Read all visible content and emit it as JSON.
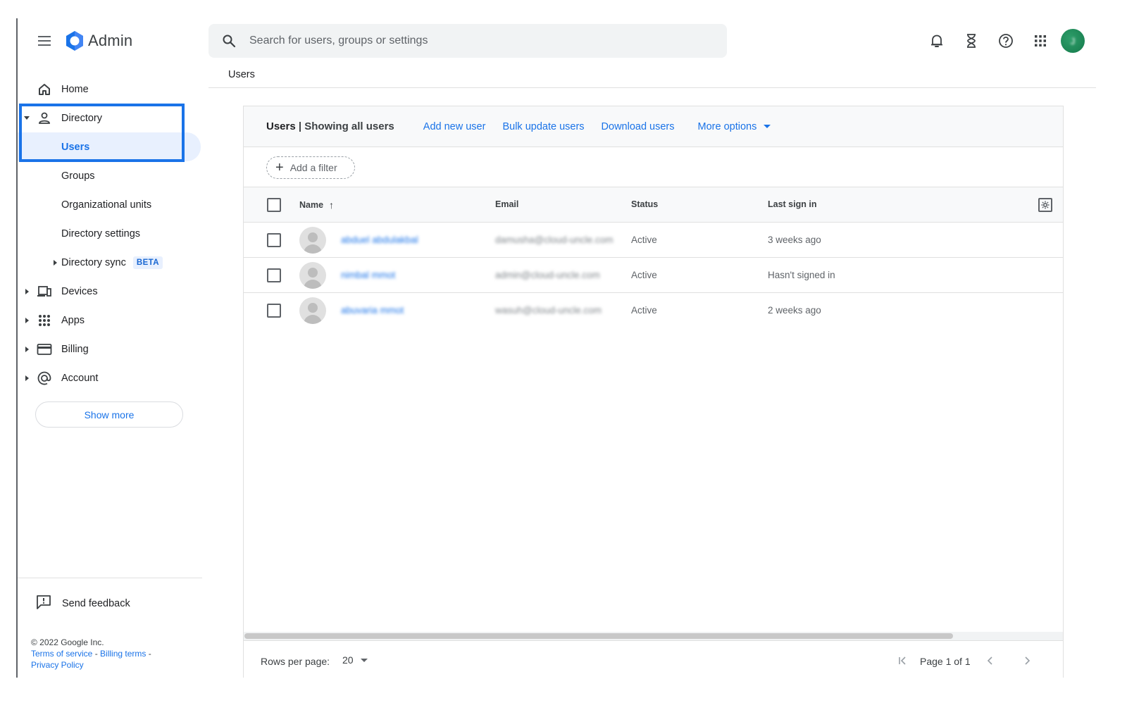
{
  "app": {
    "logo_text": "Admin"
  },
  "search": {
    "placeholder": "Search for users, groups or settings"
  },
  "header_icons": [
    "bell-icon",
    "hourglass-icon",
    "help-icon",
    "apps-grid-icon"
  ],
  "avatar_initial": "J",
  "sidebar": {
    "items": [
      {
        "label": "Home",
        "icon": "home-icon"
      },
      {
        "label": "Directory",
        "icon": "person-icon",
        "expanded": true
      },
      {
        "label": "Users",
        "selected": true
      },
      {
        "label": "Groups"
      },
      {
        "label": "Organizational units"
      },
      {
        "label": "Directory settings"
      },
      {
        "label": "Directory sync",
        "badge": "BETA"
      },
      {
        "label": "Devices",
        "icon": "devices-icon"
      },
      {
        "label": "Apps",
        "icon": "apps-icon"
      },
      {
        "label": "Billing",
        "icon": "credit-card-icon"
      },
      {
        "label": "Account",
        "icon": "at-icon"
      }
    ],
    "show_more": "Show more",
    "send_feedback": "Send feedback",
    "footer": {
      "copyright": "© 2022 Google Inc.",
      "terms": "Terms of service",
      "billing_terms": "Billing terms",
      "privacy": "Privacy Policy"
    }
  },
  "breadcrumb": "Users",
  "card": {
    "title": "Users",
    "subtitle": "| Showing all users",
    "actions": {
      "add_user": "Add new user",
      "bulk_update": "Bulk update users",
      "download": "Download users",
      "more_options": "More options"
    },
    "add_filter": "Add a filter"
  },
  "table": {
    "columns": [
      "Name",
      "Email",
      "Status",
      "Last sign in"
    ],
    "rows": [
      {
        "name": "abduel abdulakbal",
        "email": "damusha@cloud-uncle.com",
        "status": "Active",
        "last_sign_in": "3 weeks ago"
      },
      {
        "name": "nimbal mmot",
        "email": "admin@cloud-uncle.com",
        "status": "Active",
        "last_sign_in": "Hasn't signed in"
      },
      {
        "name": "abuvaria mmot",
        "email": "wasuh@cloud-uncle.com",
        "status": "Active",
        "last_sign_in": "2 weeks ago"
      }
    ]
  },
  "pagination": {
    "rows_per_page_label": "Rows per page:",
    "rows_per_page": "20",
    "page_text": "Page 1 of 1"
  },
  "colors": {
    "accent": "#1a73e8",
    "selected_bg": "#e8f0fe",
    "highlight_box": "#1a73e8"
  }
}
